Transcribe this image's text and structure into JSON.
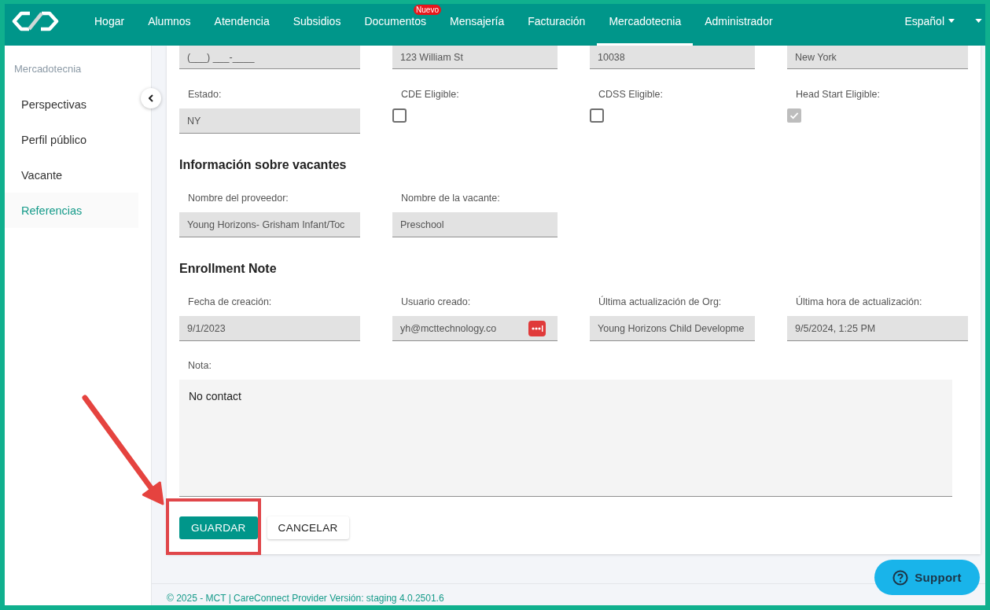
{
  "nav": {
    "items": [
      {
        "label": "Hogar",
        "selected": false
      },
      {
        "label": "Alumnos",
        "selected": false
      },
      {
        "label": "Atendencia",
        "selected": false
      },
      {
        "label": "Subsidios",
        "selected": false
      },
      {
        "label": "Documentos",
        "selected": false,
        "badge": "Nuevo"
      },
      {
        "label": "Mensajería",
        "selected": false
      },
      {
        "label": "Facturación",
        "selected": false
      },
      {
        "label": "Mercadotecnia",
        "selected": true
      },
      {
        "label": "Administrador",
        "selected": false
      }
    ],
    "language": "Español"
  },
  "sidebar": {
    "heading": "Mercadotecnia",
    "items": [
      {
        "label": "Perspectivas",
        "selected": false
      },
      {
        "label": "Perfil público",
        "selected": false
      },
      {
        "label": "Vacante",
        "selected": false
      },
      {
        "label": "Referencias",
        "selected": true
      }
    ]
  },
  "form": {
    "rows": [
      {
        "fields": [
          {
            "kind": "text",
            "value": "(___) ___-____"
          },
          {
            "kind": "text",
            "value": "123 William St"
          },
          {
            "kind": "text",
            "value": "10038"
          },
          {
            "kind": "text",
            "value": "New York"
          }
        ]
      },
      {
        "fields": [
          {
            "kind": "text",
            "label": "Estado:",
            "value": "NY"
          },
          {
            "kind": "checkbox",
            "label": "CDE Eligible:",
            "checked": false
          },
          {
            "kind": "checkbox",
            "label": "CDSS Eligible:",
            "checked": false
          },
          {
            "kind": "checkbox",
            "label": "Head Start Eligible:",
            "checked": true
          }
        ]
      }
    ],
    "sections": [
      {
        "heading": "Información sobre vacantes",
        "fields": [
          {
            "kind": "text",
            "label": "Nombre del proveedor:",
            "value": "Young Horizons- Grisham Infant/Toc"
          },
          {
            "kind": "text",
            "label": "Nombre de la vacante:",
            "value": "Preschool"
          }
        ]
      },
      {
        "heading": "Enrollment Note",
        "fields": [
          {
            "kind": "text",
            "label": "Fecha de creación:",
            "value": "9/1/2023"
          },
          {
            "kind": "text",
            "label": "Usuario creado:",
            "value": "yh@mcttechnology.co",
            "action_icon": true
          },
          {
            "kind": "text",
            "label": "Última actualización de Org:",
            "value": "Young Horizons Child Developme"
          },
          {
            "kind": "text",
            "label": "Última hora de actualización:",
            "value": "9/5/2024, 1:25 PM"
          }
        ],
        "note": {
          "label": "Nota:",
          "value": "No contact"
        }
      }
    ],
    "buttons": [
      {
        "label": "GUARDAR",
        "kind": "primary"
      },
      {
        "label": "CANCELAR",
        "kind": "secondary"
      }
    ]
  },
  "support": {
    "label": "Support"
  },
  "footer": {
    "text": "© 2025 - MCT | CareConnect Provider Versión: staging 4.0.2501.6"
  }
}
